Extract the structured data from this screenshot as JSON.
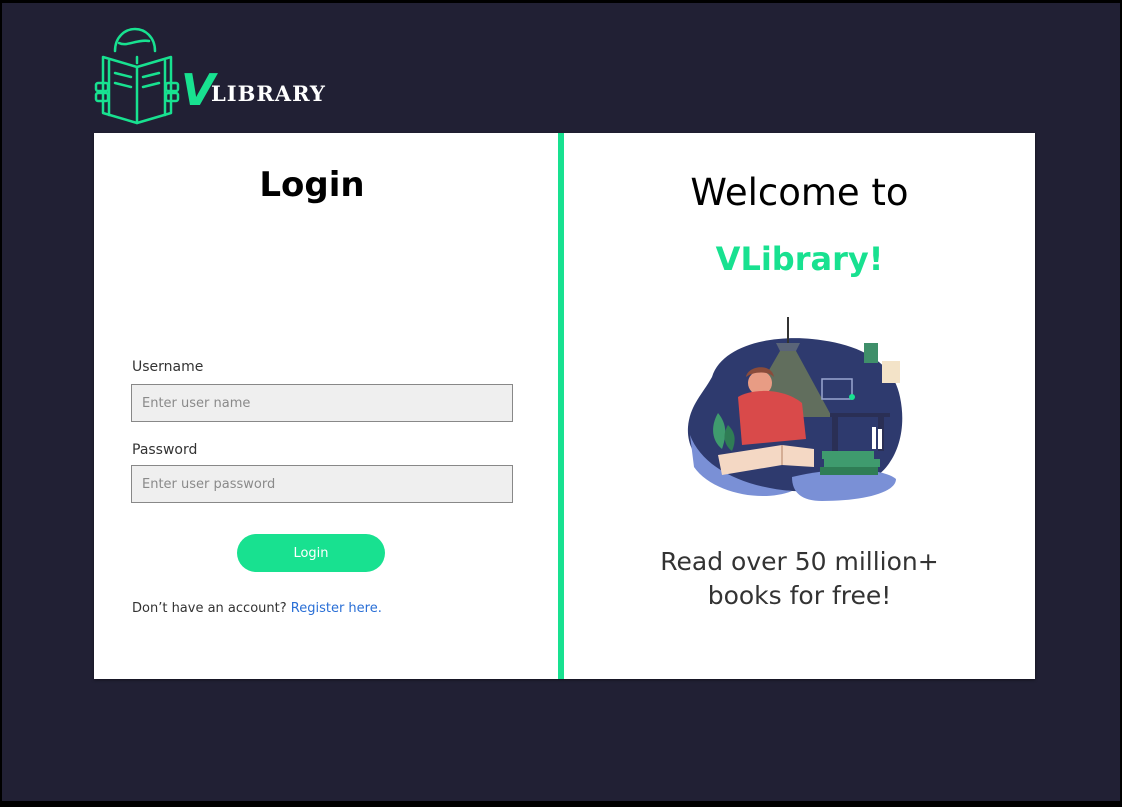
{
  "brand": {
    "logo_text_v": "V",
    "logo_text_rest": "LIBRARY",
    "accent_color": "#18e190",
    "background_color": "#212034"
  },
  "login": {
    "title": "Login",
    "username_label": "Username",
    "username_placeholder": "Enter user name",
    "username_value": "",
    "password_label": "Password",
    "password_placeholder": "Enter user password",
    "password_value": "",
    "submit_label": "Login",
    "register_prompt": "Don’t have an account?",
    "register_link": "Register here."
  },
  "welcome": {
    "line1": "Welcome to",
    "line2": "VLibrary!",
    "illustration_icon": "person-reading-book-illustration",
    "tagline_line1": "Read over 50 million+",
    "tagline_line2": "books for free!"
  }
}
